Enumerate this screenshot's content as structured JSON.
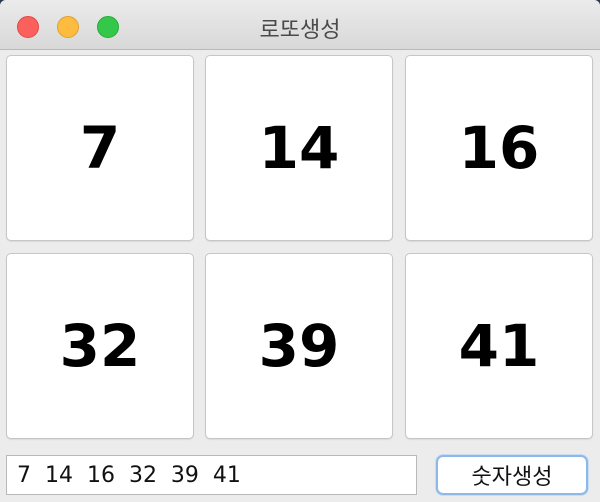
{
  "window": {
    "title": "로또생성"
  },
  "numbers": [
    "7",
    "14",
    "16",
    "32",
    "39",
    "41"
  ],
  "result": {
    "value": "7  14  16  32  39  41"
  },
  "generate_button": {
    "label": "숫자생성"
  },
  "colors": {
    "close": "#fc605c",
    "minimize": "#fdbc40",
    "maximize": "#34c84a",
    "button_focus_border": "#8db8e8"
  }
}
